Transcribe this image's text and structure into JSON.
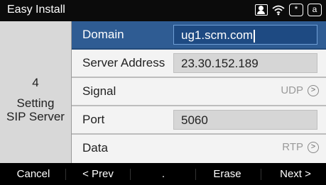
{
  "title_bar": {
    "title": "Easy Install",
    "icons": [
      "contact-icon",
      "wifi-icon",
      "star-key-icon",
      "alpha-key-icon"
    ],
    "star_key": "*",
    "alpha_key": "a"
  },
  "wizard": {
    "step_number": "4",
    "step_label_line1": "Setting",
    "step_label_line2": "SIP Server"
  },
  "fields": [
    {
      "label": "Domain",
      "value": "ug1.scm.com",
      "type": "text",
      "active": true
    },
    {
      "label": "Server Address",
      "value": "23.30.152.189",
      "type": "text",
      "active": false
    },
    {
      "label": "Signal",
      "value": "UDP",
      "type": "option",
      "active": false
    },
    {
      "label": "Port",
      "value": "5060",
      "type": "text",
      "active": false
    },
    {
      "label": "Data",
      "value": "RTP",
      "type": "option",
      "active": false
    }
  ],
  "softkeys": [
    "Cancel",
    "< Prev",
    ".",
    "Erase",
    "Next >"
  ],
  "colors": {
    "active_row": "#2f5c93",
    "row_bg": "#f3f3f3",
    "left_panel": "#d8d8d8",
    "bar_bg": "#000000"
  }
}
